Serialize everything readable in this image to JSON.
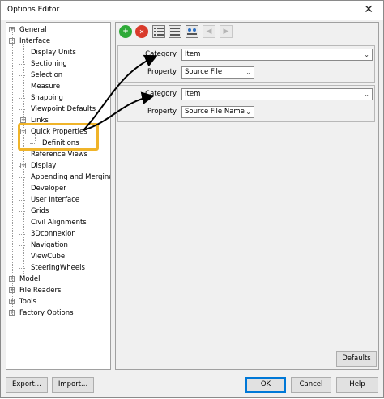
{
  "window": {
    "title": "Options Editor",
    "close_glyph": "✕"
  },
  "tree": {
    "items": [
      {
        "label": "General",
        "expander": "+"
      },
      {
        "label": "Interface",
        "expander": "−"
      },
      {
        "label": "Display Units"
      },
      {
        "label": "Sectioning"
      },
      {
        "label": "Selection"
      },
      {
        "label": "Measure"
      },
      {
        "label": "Snapping"
      },
      {
        "label": "Viewpoint Defaults"
      },
      {
        "label": "Links",
        "expander": "+"
      },
      {
        "label": "Quick Properties",
        "expander": "−"
      },
      {
        "label": "Definitions"
      },
      {
        "label": "Reference Views"
      },
      {
        "label": "Display",
        "expander": "+"
      },
      {
        "label": "Appending and Merging"
      },
      {
        "label": "Developer"
      },
      {
        "label": "User Interface"
      },
      {
        "label": "Grids"
      },
      {
        "label": "Civil Alignments"
      },
      {
        "label": "3Dconnexion"
      },
      {
        "label": "Navigation"
      },
      {
        "label": "ViewCube"
      },
      {
        "label": "SteeringWheels"
      },
      {
        "label": "Model",
        "expander": "+"
      },
      {
        "label": "File Readers",
        "expander": "+"
      },
      {
        "label": "Tools",
        "expander": "+"
      },
      {
        "label": "Factory Options",
        "expander": "+"
      }
    ]
  },
  "toolbar": {
    "add_glyph": "+",
    "delete_glyph": "✕",
    "prev_glyph": "◀",
    "next_glyph": "▶"
  },
  "definitions": [
    {
      "category_label": "Category",
      "category_value": "Item",
      "property_label": "Property",
      "property_value": "Source File"
    },
    {
      "category_label": "Category",
      "category_value": "Item",
      "property_label": "Property",
      "property_value": "Source File Name"
    }
  ],
  "combo_arrow": "⌄",
  "buttons": {
    "defaults": "Defaults",
    "export": "Export...",
    "import": "Import...",
    "ok": "OK",
    "cancel": "Cancel",
    "help": "Help"
  },
  "colors": {
    "highlight": "#f0b429",
    "add": "#2eaa38",
    "delete": "#d93a2b",
    "focus": "#0078d7"
  }
}
